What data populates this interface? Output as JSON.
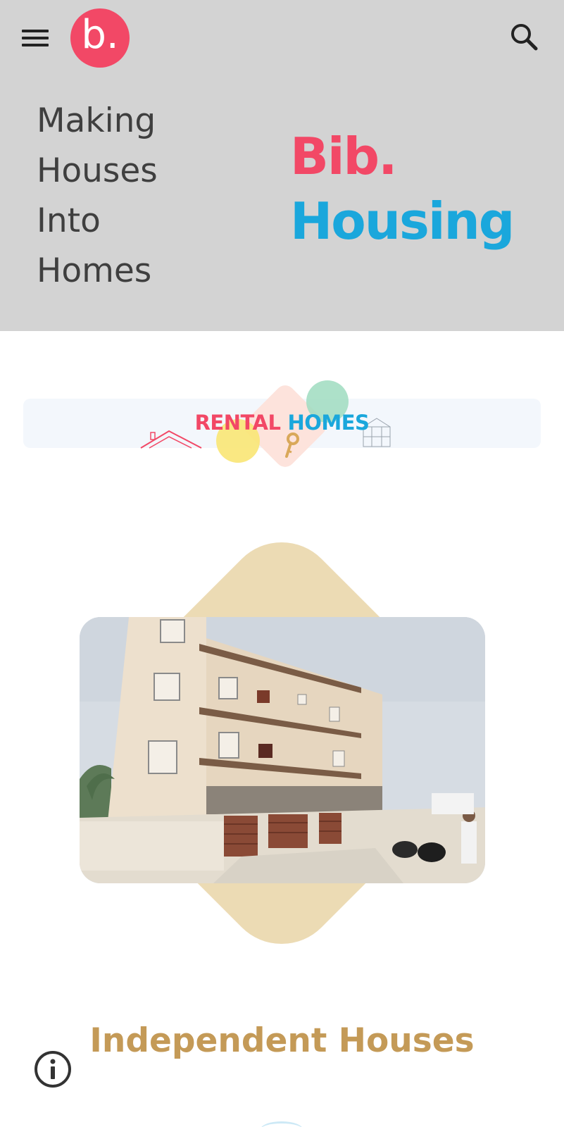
{
  "header": {
    "menu_icon": "hamburger-menu-icon",
    "logo_letter": "b.",
    "search_icon": "search-icon"
  },
  "hero": {
    "tagline_lines": [
      "Making",
      "Houses",
      "Into",
      "Homes"
    ],
    "brand_line1": "Bib.",
    "brand_line2": "Housing"
  },
  "banner": {
    "word1": "RENTAL",
    "word2": "HOMES"
  },
  "category": {
    "title": "Independent Houses"
  },
  "footer": {
    "info_icon": "info-icon"
  },
  "colors": {
    "brand_pink": "#f24866",
    "brand_blue": "#1aa7dc",
    "hero_bg": "#d3d3d3",
    "diamond_beige": "#ecdbb4",
    "category_title": "#c49a57"
  }
}
